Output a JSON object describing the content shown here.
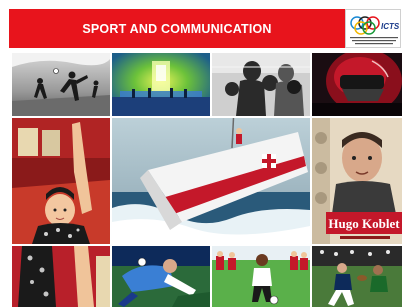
{
  "banner": {
    "title": "SPORT AND COMMUNICATION",
    "background_color": "#e8141c",
    "text_color": "#ffffff"
  },
  "logo": {
    "name": "FICTS",
    "subtitle": "FEDERATION INTERNATIONALE CINEMA TELEVISION SPORTIFS"
  },
  "photo_grid": {
    "tiles": [
      {
        "name": "photo-football-bw"
      },
      {
        "name": "photo-stage-event"
      },
      {
        "name": "photo-boxing-bw"
      },
      {
        "name": "photo-helmet-closeup"
      },
      {
        "name": "photo-gymnast-girl"
      },
      {
        "name": "photo-sailing-yacht"
      },
      {
        "name": "photo-hugo-koblet-poster",
        "text": "Hugo Koblet"
      },
      {
        "name": "photo-gymnast-bottom"
      },
      {
        "name": "photo-football-diving"
      },
      {
        "name": "photo-soccer-boy"
      },
      {
        "name": "photo-rugby"
      }
    ]
  }
}
